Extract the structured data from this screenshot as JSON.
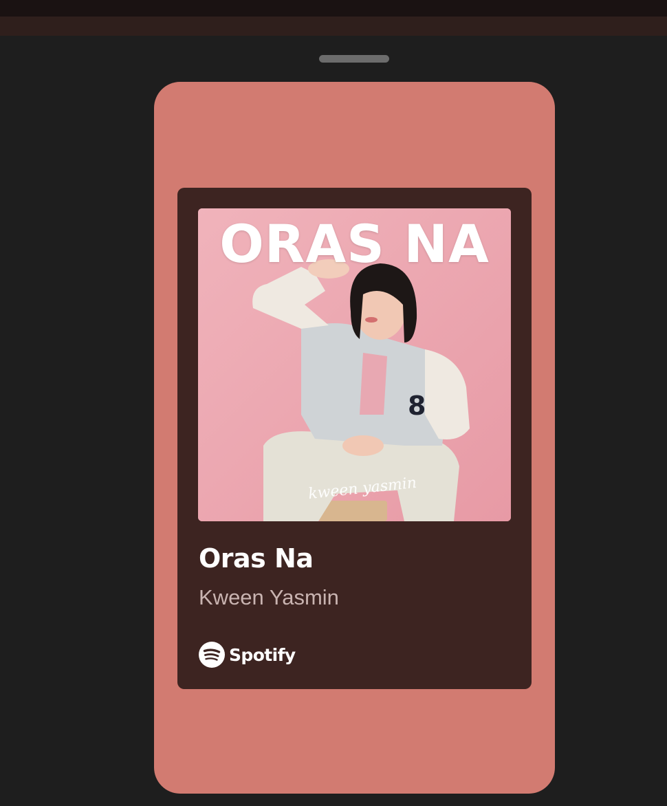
{
  "card": {
    "background_color": "#d27b71",
    "panel_color": "#3d2421"
  },
  "cover": {
    "title": "ORAS NA",
    "signature": "kween yasmin",
    "background_color": "#eba8b1"
  },
  "track": {
    "title": "Oras Na",
    "artist": "Kween Yasmin"
  },
  "brand": {
    "icon": "spotify-icon",
    "name": "Spotify"
  }
}
